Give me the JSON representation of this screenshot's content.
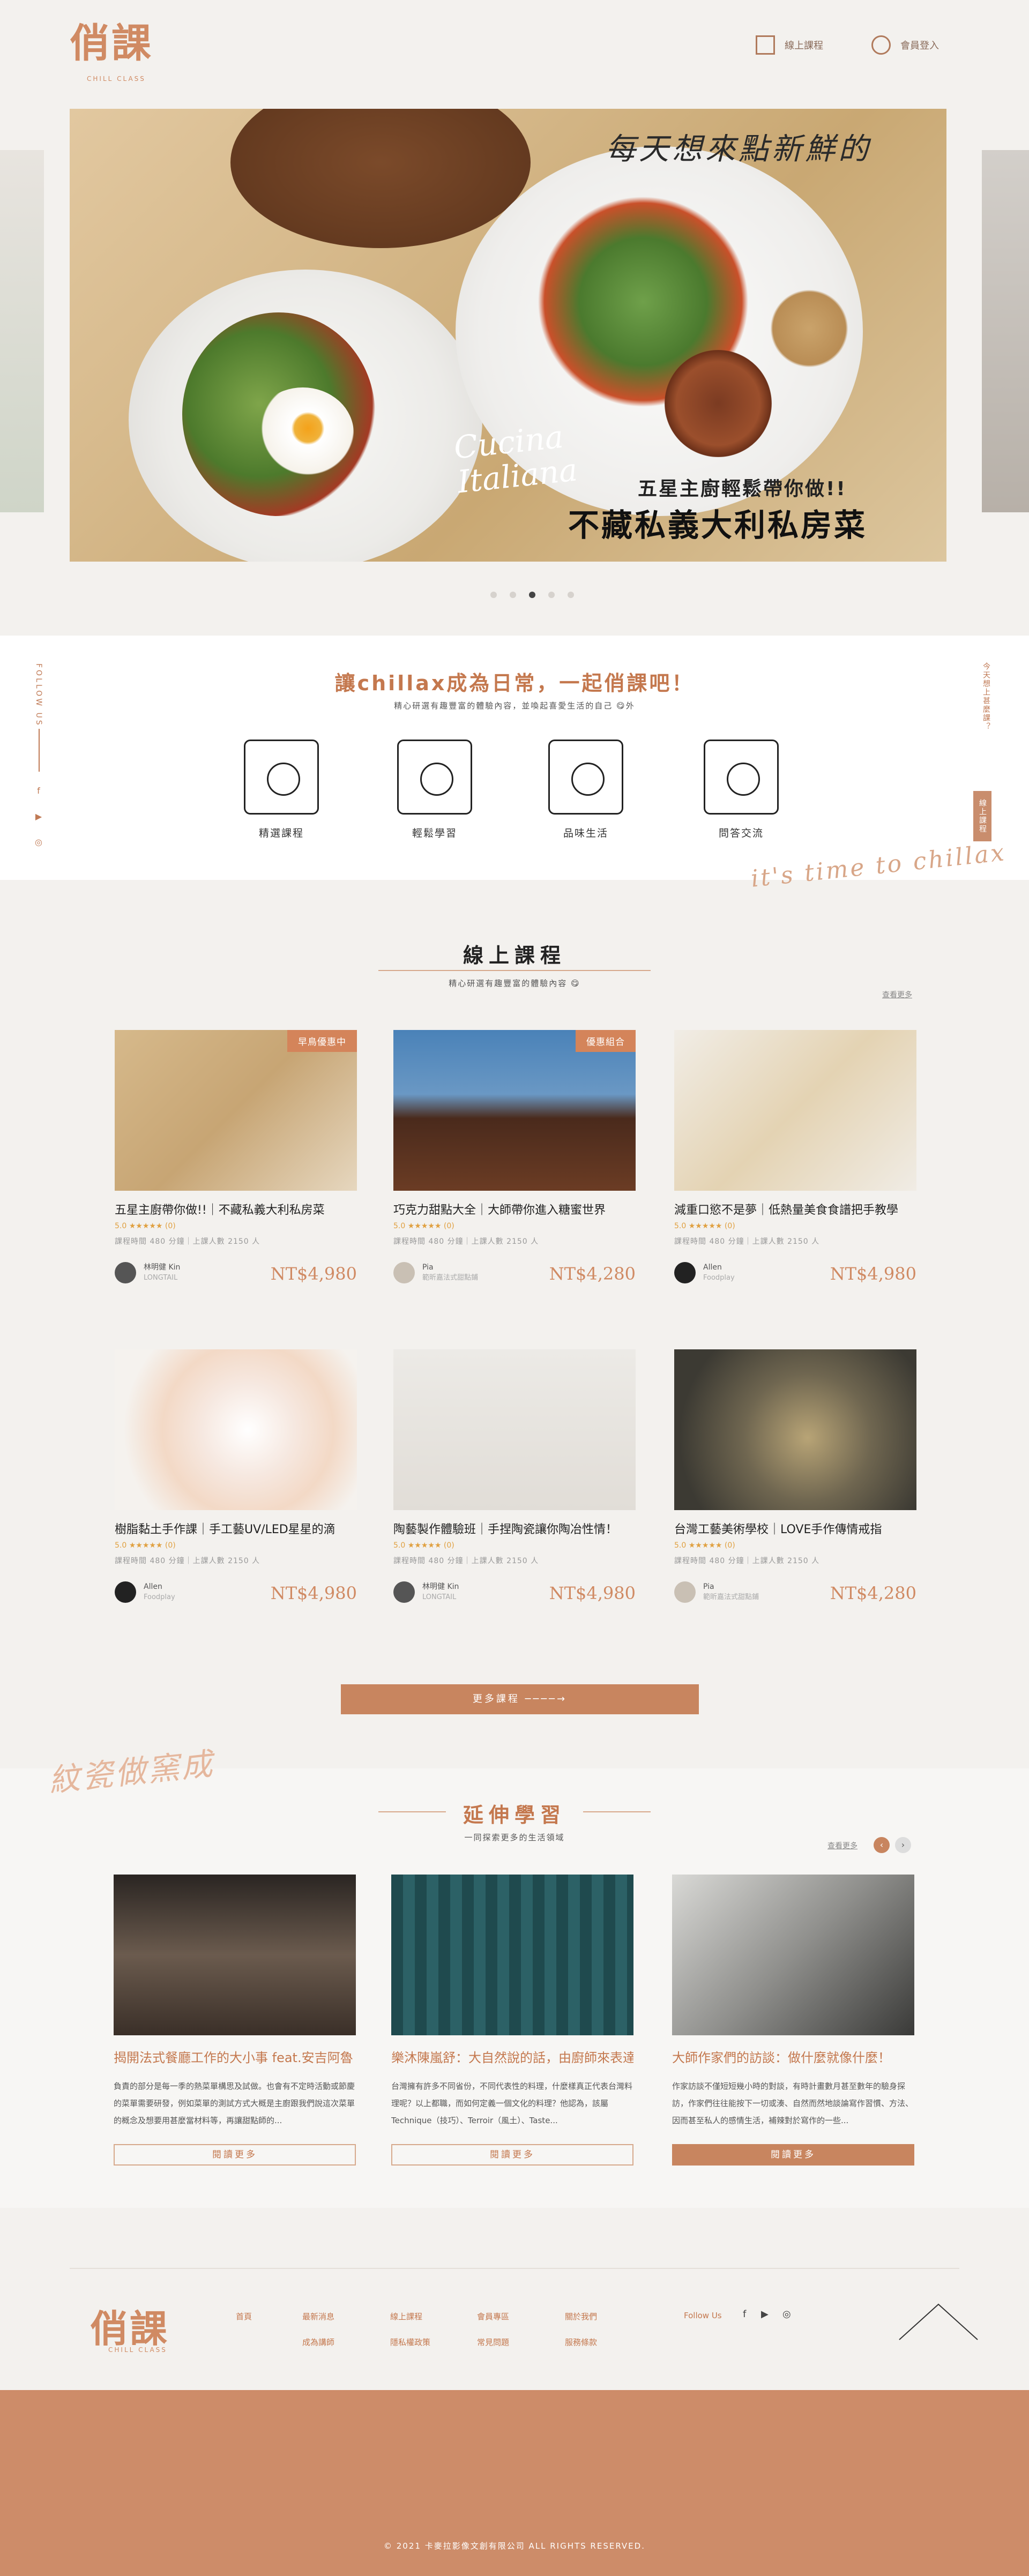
{
  "header": {
    "logo": "俏課",
    "logo_sub": "CHILL CLASS",
    "nav": [
      {
        "label": "線上課程",
        "icon": "book-icon"
      },
      {
        "label": "會員登入",
        "icon": "user-icon"
      }
    ]
  },
  "hero": {
    "script_text": "每天想來點新鮮的",
    "cucina": "Cucina\nItaliana",
    "subtitle": "五星主廚輕鬆帶你做!!",
    "title": "不藏私義大利私房菜",
    "dots": 5,
    "active_dot": 2
  },
  "intro": {
    "follow_label": "FOLLOW US",
    "social": [
      "facebook-icon",
      "youtube-icon",
      "instagram-icon"
    ],
    "title": "讓chillax成為日常，一起俏課吧！",
    "subtitle": "精心研選有趣豐富的體驗內容，並喚起喜愛生活的自己 😋外",
    "features": [
      {
        "label": "精選課程",
        "icon": "camera-person-icon"
      },
      {
        "label": "輕鬆學習",
        "icon": "guitar-person-icon"
      },
      {
        "label": "品味生活",
        "icon": "painting-person-icon"
      },
      {
        "label": "問答交流",
        "icon": "chat-person-icon"
      }
    ],
    "side_note": "今天想上甚麼課？",
    "side_button": "線上課程",
    "script_time": "it's time to chillax"
  },
  "courses": {
    "title": "線上課程",
    "subtitle": "精心研選有趣豐富的體驗內容 😋",
    "more_link": "查看更多",
    "items": [
      {
        "title": "五星主廚帶你做!!｜不藏私義大利私房菜",
        "badge": "早鳥優惠中",
        "rating": "5.0 ★★★★★ (0)",
        "meta": "課程時間 480 分鐘｜上課人數 2150 人",
        "teacher": "林明健 Kin",
        "company": "LONGTAIL",
        "price": "NT$4,980",
        "img": "pasta"
      },
      {
        "title": "巧克力甜點大全｜大師帶你進入糖蜜世界",
        "badge": "優惠組合",
        "rating": "5.0 ★★★★★ (0)",
        "meta": "課程時間 480 分鐘｜上課人數 2150 人",
        "teacher": "Pia",
        "company": "範昕嘉法式甜點鋪",
        "price": "NT$4,280",
        "img": "chocolate"
      },
      {
        "title": "減重口慾不是夢｜低熱量美食食譜把手教學",
        "badge": "",
        "rating": "5.0 ★★★★★ (0)",
        "meta": "課程時間 480 分鐘｜上課人數 2150 人",
        "teacher": "Allen",
        "company": "Foodplay",
        "price": "NT$4,980",
        "img": "wrap"
      },
      {
        "title": "樹脂黏土手作課｜手工藝UV/LED星星的滴",
        "badge": "",
        "rating": "5.0 ★★★★★ (0)",
        "meta": "課程時間 480 分鐘｜上課人數 2150 人",
        "teacher": "Allen",
        "company": "Foodplay",
        "price": "NT$4,980",
        "img": "resin"
      },
      {
        "title": "陶藝製作體驗班｜手捏陶瓷讓你陶冶性情！",
        "badge": "",
        "rating": "5.0 ★★★★★ (0)",
        "meta": "課程時間 480 分鐘｜上課人數 2150 人",
        "teacher": "林明健 Kin",
        "company": "LONGTAIL",
        "price": "NT$4,980",
        "img": "pottery"
      },
      {
        "title": "台灣工藝美術學校｜LOVE手作傳情戒指",
        "badge": "",
        "rating": "5.0 ★★★★★ (0)",
        "meta": "課程時間 480 分鐘｜上課人數 2150 人",
        "teacher": "Pia",
        "company": "範昕嘉法式甜點鋪",
        "price": "NT$4,280",
        "img": "ring"
      }
    ],
    "more_button": "更多課程 ────→",
    "script_ink": "紋瓷做窯成"
  },
  "extended": {
    "title": "延伸學習",
    "subtitle": "一同探索更多的生活領域",
    "more_link": "查看更多",
    "items": [
      {
        "title": "揭開法式餐廳工作的大小事 feat.安吉阿魯",
        "desc": "負責的部分是每一季的熱菜單構思及試做。也會有不定時活動或節慶的菜單需要研發，例如菜單的測試方式大概是主廚跟我們說這次菜單的概念及想要用甚麼當材料等，再讓甜點師的...",
        "button": "閱讀更多",
        "img": "kitchen"
      },
      {
        "title": "樂沐陳嵐舒：大自然說的話，由廚師來表達",
        "desc": "台灣擁有許多不同省份，不同代表性的料理，什麼樣真正代表台灣料理呢？以上都職，而如何定義一個文化的料理？他認為，該屬Technique（技巧）、Terroir（風土）、Taste...",
        "button": "閱讀更多",
        "img": "chef"
      },
      {
        "title": "大師作家們的訪談：做什麼就像什麼！",
        "desc": "作家訪談不僅短短幾小時的對談，有時計畫數月甚至數年的驗身探訪，作家們往往能按下一切或湊、自然而然地談論寫作習慣、方法、因而甚至私人的感情生活，補辣對於寫作的一些...",
        "button": "閱讀更多",
        "img": "writer"
      }
    ]
  },
  "footer": {
    "logo": "俏課",
    "logo_sub": "CHILL CLASS",
    "links_row1": [
      "首頁",
      "最新消息",
      "線上課程",
      "會員專區",
      "關於我們"
    ],
    "links_row2": [
      "成為講師",
      "隱私權政策",
      "常見問題",
      "服務條款"
    ],
    "follow_label": "Follow Us",
    "social": [
      "facebook-icon",
      "youtube-icon",
      "instagram-icon"
    ],
    "copyright": "© 2021 卡麥拉影像文創有限公司 ALL RIGHTS RESERVED."
  }
}
